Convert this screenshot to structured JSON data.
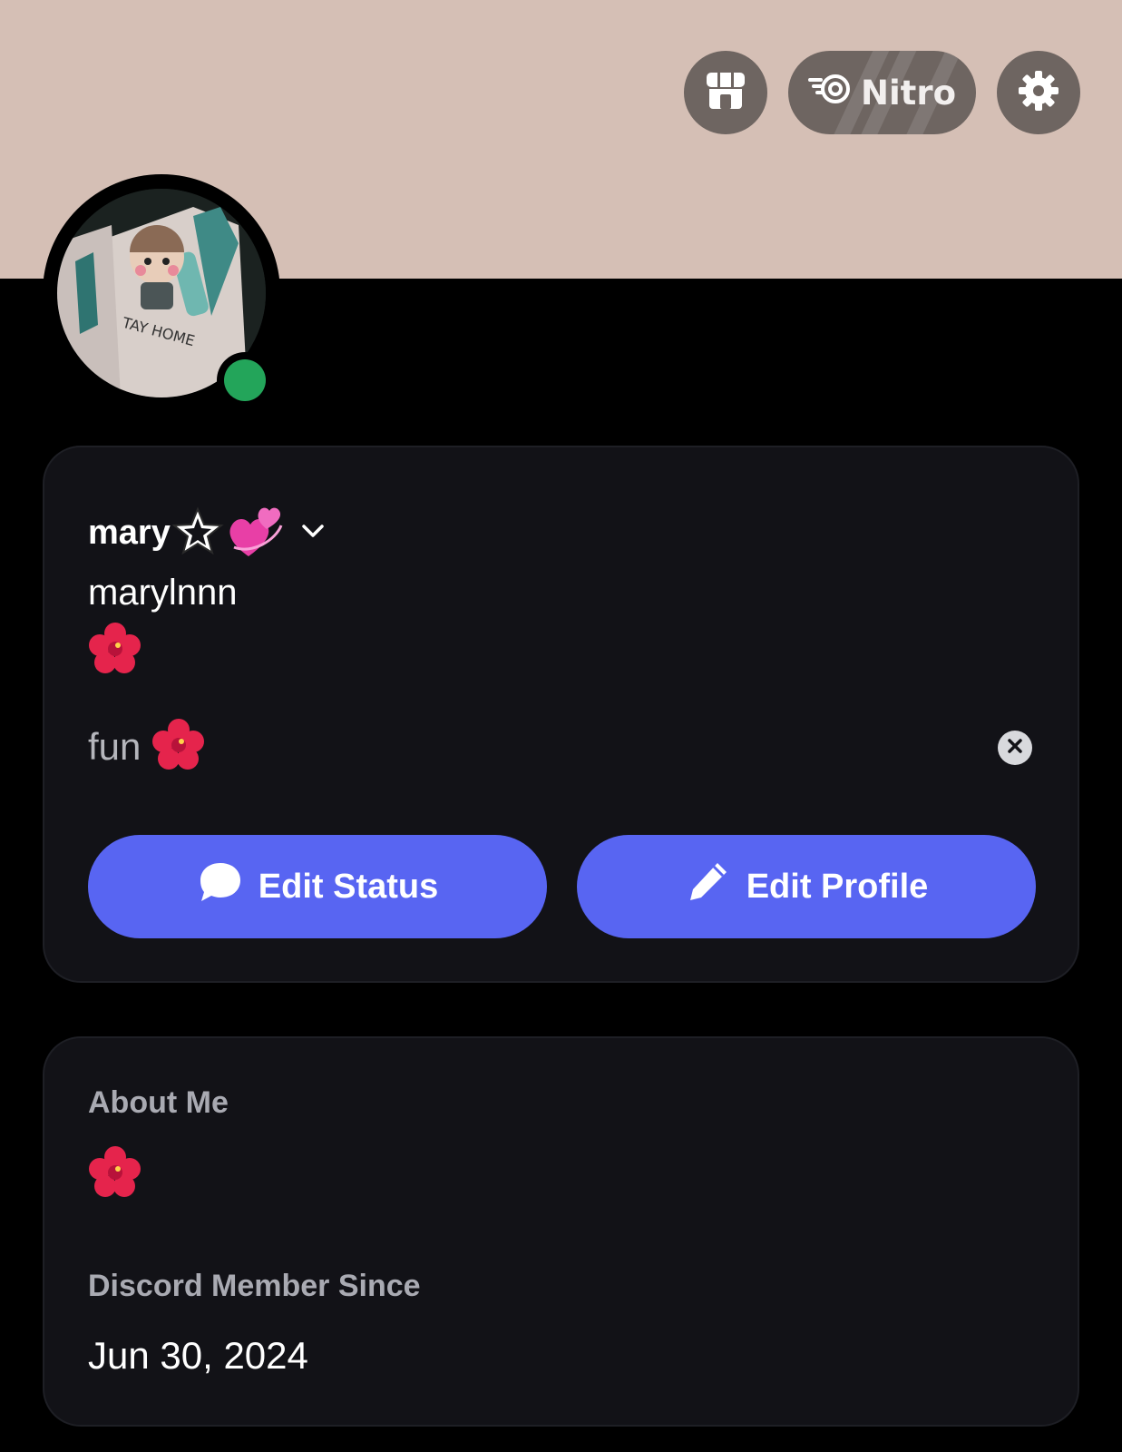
{
  "banner": {
    "color": "#d5bfb5"
  },
  "header": {
    "shop_icon": "shop-icon",
    "nitro_label": "Nitro",
    "nitro_icon": "nitro-icon",
    "settings_icon": "gear-icon"
  },
  "profile": {
    "display_name": "mary",
    "display_name_decorations": [
      "star-icon",
      "revolving-hearts-icon"
    ],
    "username": "marylnnn",
    "pronoun_emoji": "hibiscus-emoji",
    "online_status_color": "#23a55a",
    "custom_status": {
      "text": "fun",
      "emoji": "hibiscus-emoji"
    }
  },
  "actions": {
    "edit_status_label": "Edit Status",
    "edit_profile_label": "Edit Profile",
    "accent_color": "#5865f2"
  },
  "about": {
    "about_me_label": "About Me",
    "about_me_emoji": "hibiscus-emoji",
    "member_since_label": "Discord Member Since",
    "member_since_date": "Jun 30, 2024"
  }
}
